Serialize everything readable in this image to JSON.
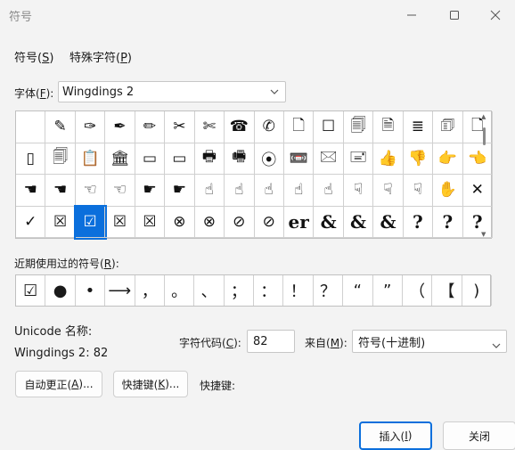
{
  "window": {
    "title": "符号"
  },
  "tabs": [
    {
      "label": "符号(",
      "key": "S",
      "suffix": ")"
    },
    {
      "label": "特殊字符(",
      "key": "P",
      "suffix": ")"
    }
  ],
  "font": {
    "label_prefix": "字体(",
    "label_key": "F",
    "label_suffix": "):",
    "value": "Wingdings 2"
  },
  "symbols": [
    "",
    "✎",
    "✑",
    "✒",
    "✏",
    "✂",
    "✄",
    "☎",
    "✆",
    "🗋",
    "☐",
    "🗐",
    "🗎",
    "≣",
    "🗊",
    "🗋",
    "▯",
    "🗐",
    "📋",
    "🏛",
    "▭",
    "▭",
    "🖶",
    "🖷",
    "⦿",
    "📼",
    "🖂",
    "🖃",
    "👍",
    "👎",
    "👉",
    "👈",
    "☚",
    "☚",
    "☜",
    "☜",
    "☛",
    "☛",
    "☝",
    "☝",
    "☝",
    "☝",
    "☝",
    "☟",
    "☟",
    "☟",
    "✋",
    "✕",
    "✓",
    "☒",
    "☑",
    "☒",
    "☒",
    "⊗",
    "⊗",
    "⊘",
    "⊘",
    "er",
    "&",
    "&",
    "&",
    "?",
    "?",
    "?"
  ],
  "recent": {
    "label_prefix": "近期使用过的符号(",
    "label_key": "R",
    "label_suffix": "):",
    "items": [
      "☑",
      "●",
      "•",
      "⟶",
      "，",
      "。",
      "、",
      "；",
      "：",
      "！",
      "？",
      "“",
      "”",
      "（",
      "【",
      ")"
    ]
  },
  "unicode": {
    "name_label": "Unicode 名称:",
    "name_value": "Wingdings 2: 82"
  },
  "char_code": {
    "label_prefix": "字符代码(",
    "label_key": "C",
    "label_suffix": "):",
    "value": "82"
  },
  "from": {
    "label_prefix": "来自(",
    "label_key": "M",
    "label_suffix": "):",
    "value": "符号(十进制)"
  },
  "buttons": {
    "autocorrect_prefix": "自动更正(",
    "autocorrect_key": "A",
    "autocorrect_suffix": ")...",
    "shortcut_prefix": "快捷键(",
    "shortcut_key": "K",
    "shortcut_suffix": ")...",
    "shortcut_label": "快捷键:",
    "insert_prefix": "插入(",
    "insert_key": "I",
    "insert_suffix": ")",
    "close": "关闭"
  }
}
